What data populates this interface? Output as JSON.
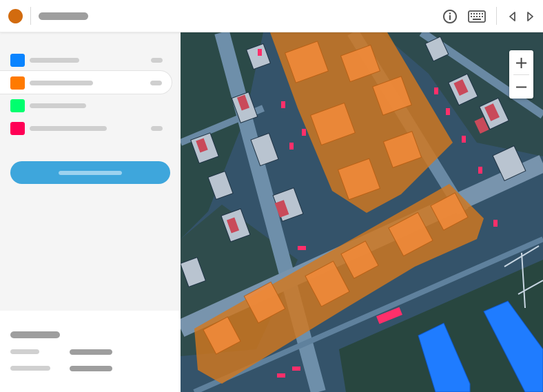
{
  "colors": {
    "brand": "#d26b0f",
    "accent_button": "#3ea6dc",
    "layer_colors": [
      "#0a84ff",
      "#ff7a00",
      "#00ff6e",
      "#ff0055"
    ],
    "selection_orange": "#d2781e",
    "selection_blue": "#1f7cff"
  },
  "header": {
    "logo_icon": "circle-logo",
    "icons": [
      "info-icon",
      "keyboard-icon",
      "prev-icon",
      "next-icon"
    ]
  },
  "map": {
    "zoom_in_label": "+",
    "zoom_out_label": "−"
  }
}
